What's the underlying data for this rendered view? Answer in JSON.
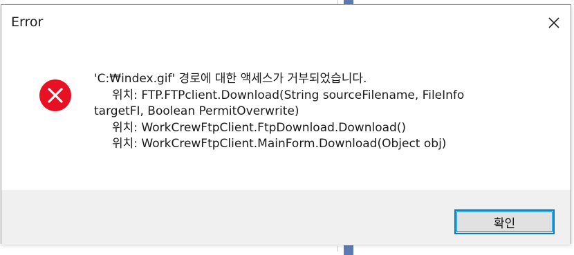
{
  "dialog": {
    "title": "Error",
    "close_icon": "close-icon",
    "status_icon": "error-icon",
    "error_color": "#e81123",
    "message_lines": [
      "'C:₩index.gif' 경로에 대한 액세스가 거부되었습니다.",
      "위치: FTP.FTPclient.Download(String sourceFilename, FileInfo",
      "targetFI, Boolean PermitOverwrite)",
      "위치: WorkCrewFtpClient.FtpDownload.Download()",
      "위치: WorkCrewFtpClient.MainForm.Download(Object obj)"
    ],
    "ok_label": "확인",
    "accent": "#0078d7"
  }
}
